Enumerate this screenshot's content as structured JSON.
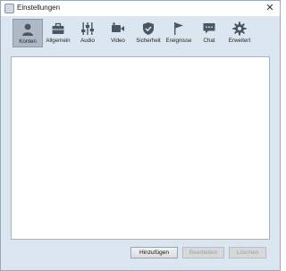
{
  "window": {
    "title": "Einstellungen",
    "close_glyph": "✕"
  },
  "toolbar": {
    "items": [
      {
        "label": "Konten",
        "icon": "user-icon",
        "active": true
      },
      {
        "label": "Allgemein",
        "icon": "briefcase-icon",
        "active": false
      },
      {
        "label": "Audio",
        "icon": "equalizer-icon",
        "active": false
      },
      {
        "label": "Video",
        "icon": "camera-icon",
        "active": false
      },
      {
        "label": "Sicherheit",
        "icon": "shield-icon",
        "active": false
      },
      {
        "label": "Ereignisse",
        "icon": "flag-icon",
        "active": false
      },
      {
        "label": "Chat",
        "icon": "chat-icon",
        "active": false
      },
      {
        "label": "Erweitert",
        "icon": "gear-icon",
        "active": false
      }
    ]
  },
  "accounts": {
    "items": []
  },
  "buttons": {
    "add": "Hinzufügen",
    "edit": "Bearbeiten",
    "delete": "Löschen"
  },
  "colors": {
    "window_bg": "#dce6f0",
    "active_tab": "#aeb9c6",
    "icon": "#4a5664"
  }
}
